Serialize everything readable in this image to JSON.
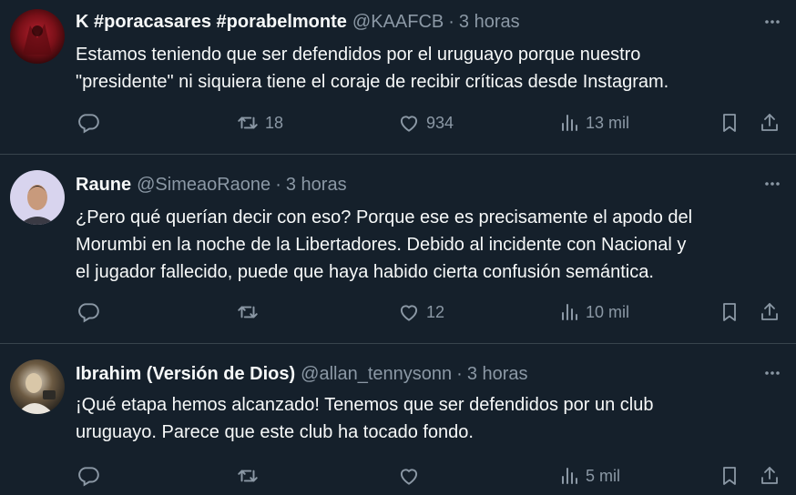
{
  "tweets": [
    {
      "name": "K #poracasares #porabelmonte",
      "handle": "@KAAFCB",
      "separator": "·",
      "time": "3 horas",
      "text_lines": [
        "Estamos teniendo que ser defendidos por el uruguayo porque nuestro",
        "\"presidente\" ni siquiera tiene el coraje de recibir críticas desde Instagram."
      ],
      "replies": "",
      "retweets": "18",
      "likes": "934",
      "views": "13 mil"
    },
    {
      "name": "Raune",
      "handle": "@SimeaoRaone",
      "separator": "·",
      "time": "3 horas",
      "text_lines": [
        "¿Pero qué querían decir con eso? Porque ese es precisamente el apodo del",
        "Morumbi en la noche de la Libertadores. Debido al incidente con Nacional y",
        "el jugador fallecido, puede que haya habido cierta confusión semántica."
      ],
      "replies": "",
      "retweets": "",
      "likes": "12",
      "views": "10 mil"
    },
    {
      "name": "Ibrahim (Versión de Dios)",
      "handle": "@allan_tennysonn",
      "separator": "·",
      "time": "3 horas",
      "text_lines": [
        "¡Qué etapa hemos alcanzado! Tenemos que ser defendidos por un club",
        "uruguayo. Parece que este club ha tocado fondo."
      ],
      "replies": "",
      "retweets": "",
      "likes": "",
      "views": "5 mil"
    }
  ],
  "icons": {
    "reply": "reply-icon",
    "retweet": "retweet-icon",
    "like": "heart-icon",
    "views": "views-icon",
    "bookmark": "bookmark-icon",
    "share": "share-icon",
    "more": "more-icon"
  },
  "colors": {
    "background": "#15202b",
    "text": "#f7f9f9",
    "secondary": "#8b98a5",
    "divider": "#38444d"
  }
}
